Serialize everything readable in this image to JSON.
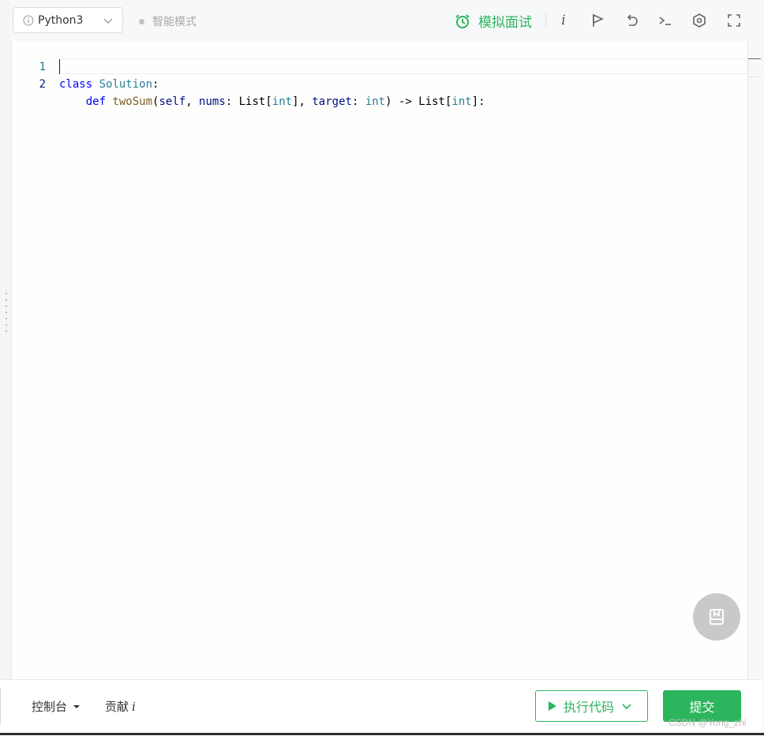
{
  "toolbar": {
    "language": "Python3",
    "smart_mode_label": "智能模式",
    "mock_interview_label": "模拟面试",
    "info_glyph": "i",
    "icons": [
      "alarm-clock-icon",
      "info-icon",
      "flag-icon",
      "reset-icon",
      "terminal-icon",
      "settings-icon",
      "fullscreen-icon"
    ]
  },
  "editor": {
    "lines": [
      {
        "number": "1",
        "text": "class Solution:"
      },
      {
        "number": "2",
        "text": "    def twoSum(self, nums: List[int], target: int) -> List[int]:"
      }
    ],
    "tokens": {
      "line1": {
        "kw": "class",
        "cls": "Solution",
        "colon": ":"
      },
      "line2": {
        "indent": "    ",
        "kw": "def",
        "fn": "twoSum",
        "p1": "self",
        "p2": "nums",
        "t_list": "List",
        "t_int": "int",
        "p3": "target",
        "arrow": "->"
      }
    }
  },
  "bottom": {
    "console_label": "控制台",
    "contribute_label": "贡献",
    "contribute_glyph": "i",
    "run_label": "执行代码",
    "submit_label": "提交",
    "watermark": "CSDN @Yong_zhi"
  },
  "colors": {
    "accent_green": "#2db55d",
    "keyword_blue": "#0000ff",
    "type_teal": "#267f99",
    "function_brown": "#795e26",
    "param_navy": "#001080"
  }
}
